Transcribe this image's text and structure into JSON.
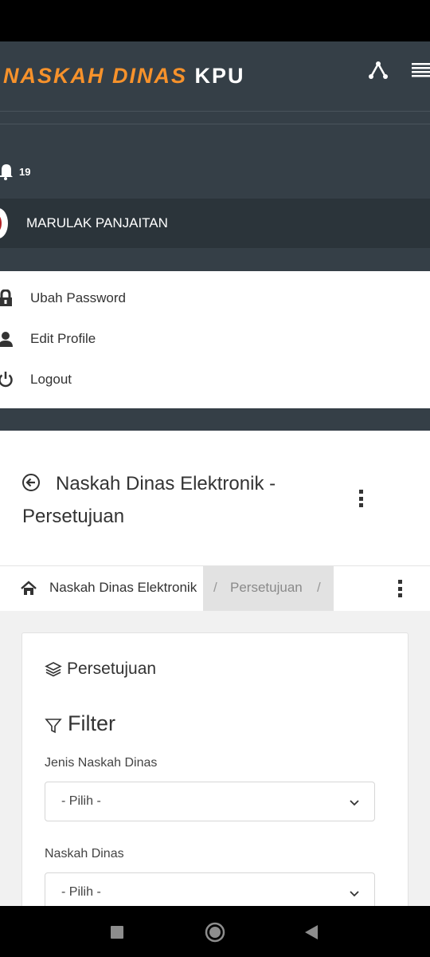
{
  "header": {
    "brand_part1": "NASKAH DINAS",
    "brand_part2": "KPU",
    "brand_color": "#f7922b",
    "header_bg": "#353f47"
  },
  "user": {
    "notification_count": "19",
    "name": "MARULAK PANJAITAN"
  },
  "user_menu": [
    {
      "label": "Ubah Password",
      "icon": "lock-icon"
    },
    {
      "label": "Edit Profile",
      "icon": "user-icon"
    },
    {
      "label": "Logout",
      "icon": "power-icon"
    }
  ],
  "page": {
    "title": "Naskah Dinas Elektronik - Persetujuan"
  },
  "breadcrumb": {
    "home_link": "Naskah Dinas Elektronik",
    "separator": "/",
    "current": "Persetujuan"
  },
  "card": {
    "title": "Persetujuan",
    "filter_title": "Filter",
    "fields": [
      {
        "label": "Jenis Naskah Dinas",
        "value": "- Pilih -"
      },
      {
        "label": "Naskah Dinas",
        "value": "- Pilih -"
      }
    ]
  }
}
